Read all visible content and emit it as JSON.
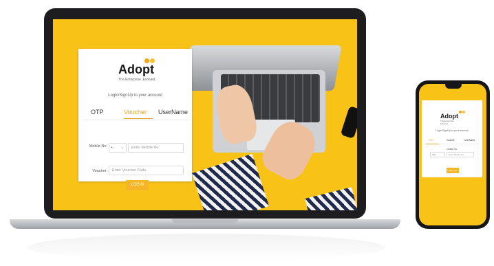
{
  "laptop": {
    "logo": "Adopt",
    "tagline": "The Enterprise. Evolved.",
    "subtitle": "Login/SignUp to your account",
    "tabs": [
      {
        "label": "OTP"
      },
      {
        "label": "Voucher"
      },
      {
        "label": "UserName"
      }
    ],
    "active_tab": "Voucher",
    "mobile_label": "Mobile No:",
    "country_value": "+..",
    "mobile_placeholder": "Enter Mobile No.",
    "voucher_label": "Voucher:",
    "voucher_placeholder": "Enter Voucher Code",
    "login_label": "LOGIN"
  },
  "phone": {
    "logo": "Adopt",
    "tagline": "The Enterprise. Evolved.",
    "subtitle": "Login/SignUp to your account",
    "tabs": [
      {
        "label": "OTP"
      },
      {
        "label": "Voucher"
      },
      {
        "label": "UserName"
      }
    ],
    "active_tab": "OTP",
    "mobile_label": "Mobile No:",
    "country_value": "+91",
    "mobile_placeholder": "Enter Mobile No.",
    "get_otp_label": "GET OTP"
  },
  "colors": {
    "background_yellow": "#f8c316",
    "accent_orange": "#f5b526",
    "active_tab": "#e6a31f"
  }
}
